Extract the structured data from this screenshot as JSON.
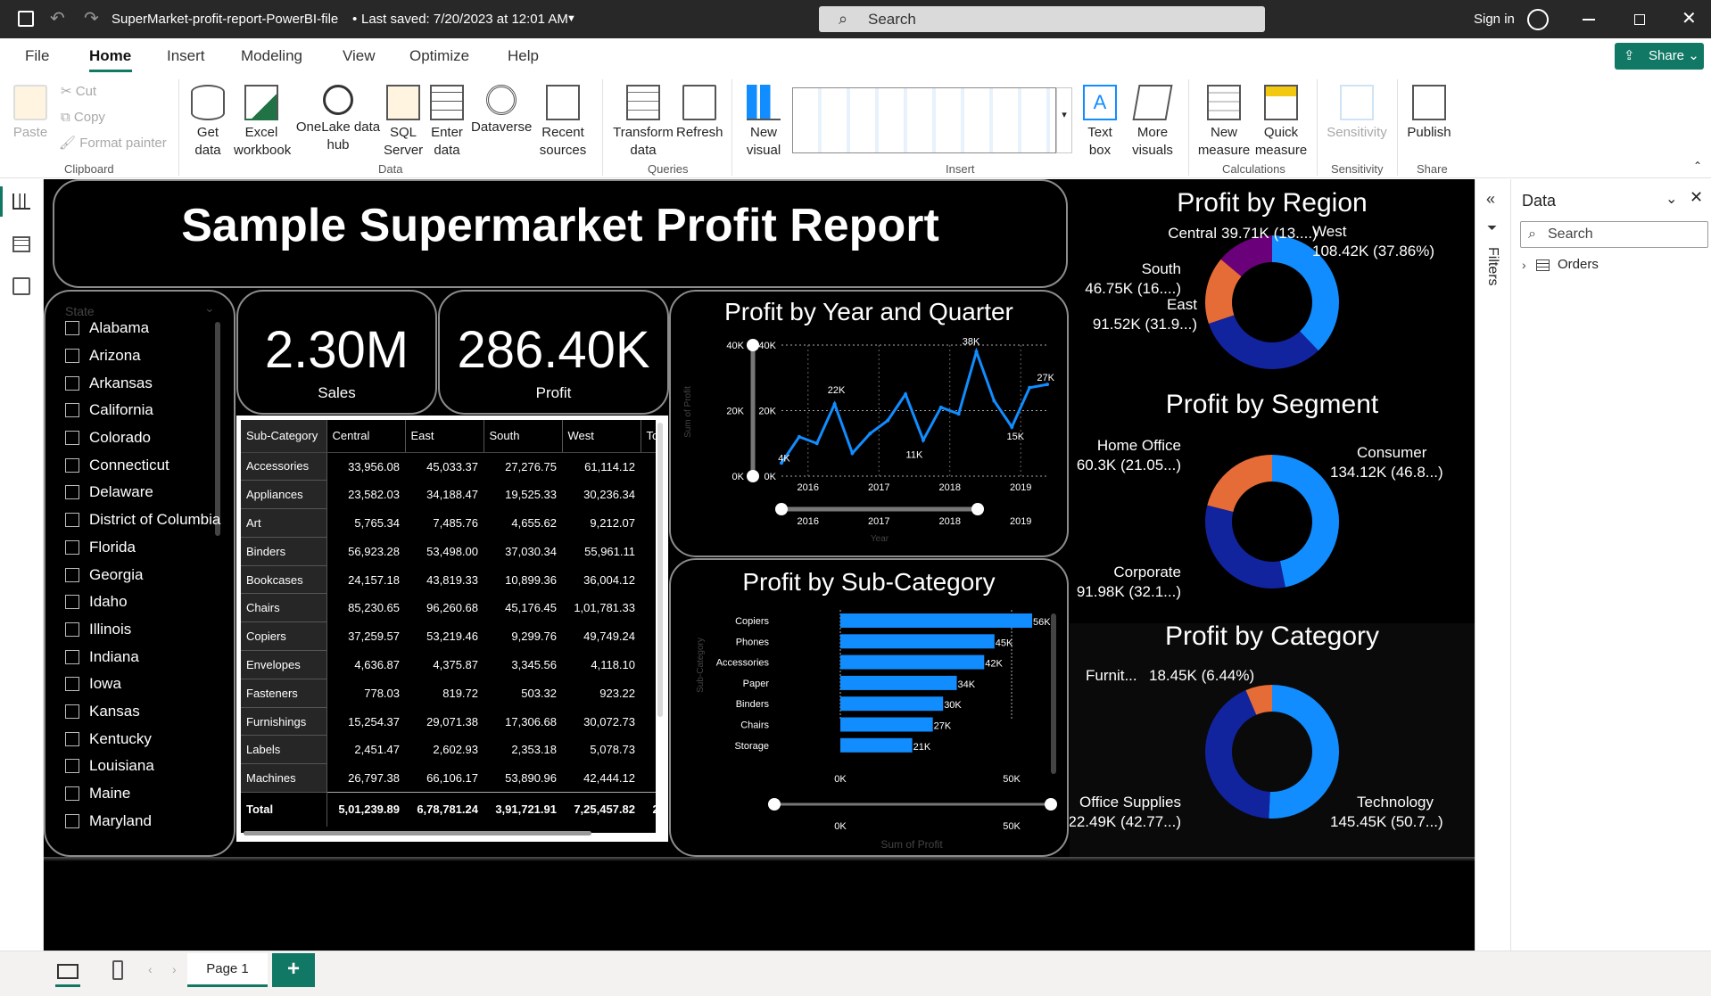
{
  "titlebar": {
    "file_title": "SuperMarket-profit-report-PowerBI-file",
    "saved": "Last saved: 7/20/2023 at 12:01 AM",
    "search_placeholder": "Search",
    "sign_in": "Sign in"
  },
  "menu": [
    "File",
    "Home",
    "Insert",
    "Modeling",
    "View",
    "Optimize",
    "Help"
  ],
  "share_label": "Share",
  "ribbon": {
    "clipboard": {
      "paste": "Paste",
      "cut": "Cut",
      "copy": "Copy",
      "format_painter": "Format painter",
      "group": "Clipboard"
    },
    "data": {
      "items": [
        "Get data",
        "Excel workbook",
        "OneLake data hub",
        "SQL Server",
        "Enter data",
        "Dataverse",
        "Recent sources"
      ],
      "group": "Data"
    },
    "queries": {
      "items": [
        "Transform data",
        "Refresh"
      ],
      "group": "Queries"
    },
    "insert": {
      "new_visual": "New visual",
      "text_box": "Text box",
      "more_visuals": "More visuals",
      "group": "Insert"
    },
    "calculations": {
      "items": [
        "New measure",
        "Quick measure"
      ],
      "group": "Calculations"
    },
    "sensitivity": {
      "item": "Sensitivity",
      "group": "Sensitivity"
    },
    "share": {
      "item": "Publish",
      "group": "Share"
    }
  },
  "report": {
    "title": "Sample Supermarket Profit Report",
    "kpi_sales": {
      "value": "2.30M",
      "label": "Sales"
    },
    "kpi_profit": {
      "value": "286.40K",
      "label": "Profit"
    },
    "state_slicer": {
      "header": "State",
      "items": [
        "Alabama",
        "Arizona",
        "Arkansas",
        "California",
        "Colorado",
        "Connecticut",
        "Delaware",
        "District of Columbia",
        "Florida",
        "Georgia",
        "Idaho",
        "Illinois",
        "Indiana",
        "Iowa",
        "Kansas",
        "Kentucky",
        "Louisiana",
        "Maine",
        "Maryland"
      ]
    },
    "matrix": {
      "headers": [
        "Sub-Category",
        "Central",
        "East",
        "South",
        "West",
        "To"
      ],
      "rows": [
        [
          "Accessories",
          "33,956.08",
          "45,033.37",
          "27,276.75",
          "61,114.12"
        ],
        [
          "Appliances",
          "23,582.03",
          "34,188.47",
          "19,525.33",
          "30,236.34"
        ],
        [
          "Art",
          "5,765.34",
          "7,485.76",
          "4,655.62",
          "9,212.07"
        ],
        [
          "Binders",
          "56,923.28",
          "53,498.00",
          "37,030.34",
          "55,961.11"
        ],
        [
          "Bookcases",
          "24,157.18",
          "43,819.33",
          "10,899.36",
          "36,004.12"
        ],
        [
          "Chairs",
          "85,230.65",
          "96,260.68",
          "45,176.45",
          "1,01,781.33"
        ],
        [
          "Copiers",
          "37,259.57",
          "53,219.46",
          "9,299.76",
          "49,749.24"
        ],
        [
          "Envelopes",
          "4,636.87",
          "4,375.87",
          "3,345.56",
          "4,118.10"
        ],
        [
          "Fasteners",
          "778.03",
          "819.72",
          "503.32",
          "923.22"
        ],
        [
          "Furnishings",
          "15,254.37",
          "29,071.38",
          "17,306.68",
          "30,072.73"
        ],
        [
          "Labels",
          "2,451.47",
          "2,602.93",
          "2,353.18",
          "5,078.73"
        ],
        [
          "Machines",
          "26,797.38",
          "66,106.17",
          "53,890.96",
          "42,444.12"
        ]
      ],
      "total": [
        "Total",
        "5,01,239.89",
        "6,78,781.24",
        "3,91,721.91",
        "7,25,457.82",
        "2"
      ]
    }
  },
  "chart_data": [
    {
      "type": "line",
      "title": "Profit by Year and Quarter",
      "xlabel": "Year",
      "ylabel": "Sum of Profit",
      "x": [
        "2016 Q1",
        "2016 Q2",
        "2016 Q3",
        "2016 Q4",
        "2017 Q1",
        "2017 Q2",
        "2017 Q3",
        "2017 Q4",
        "2018 Q1",
        "2018 Q2",
        "2018 Q3",
        "2018 Q4",
        "2019 Q1",
        "2019 Q2",
        "2019 Q3",
        "2019 Q4"
      ],
      "values": [
        4000,
        12000,
        10000,
        22000,
        7000,
        13000,
        17000,
        25000,
        11000,
        21000,
        19000,
        38000,
        23000,
        15000,
        27000,
        28000
      ],
      "data_labels": [
        "4K",
        "22K",
        "11K",
        "38K",
        "15K",
        "27K"
      ],
      "ylim": [
        0,
        40000
      ],
      "yticks": [
        "0K",
        "20K",
        "40K"
      ],
      "xticks": [
        "2016",
        "2017",
        "2018",
        "2019"
      ],
      "color": "#118DFF"
    },
    {
      "type": "bar",
      "title": "Profit by Sub-Category",
      "xlabel": "Sum of Profit",
      "ylabel": "Sub-Category",
      "categories": [
        "Copiers",
        "Phones",
        "Accessories",
        "Paper",
        "Binders",
        "Chairs",
        "Storage"
      ],
      "values": [
        56000,
        45000,
        42000,
        34000,
        30000,
        27000,
        21000
      ],
      "data_labels": [
        "56K",
        "45K",
        "42K",
        "34K",
        "30K",
        "27K",
        "21K"
      ],
      "xlim": [
        0,
        50000
      ],
      "xticks": [
        "0K",
        "50K"
      ],
      "color": "#118DFF"
    },
    {
      "type": "pie",
      "title": "Profit by Region",
      "donut": true,
      "slices": [
        {
          "label": "West",
          "value": 108.42,
          "text": "West",
          "val_text": "108.42K (37.86%)",
          "color": "#118DFF"
        },
        {
          "label": "East",
          "value": 91.52,
          "text": "East",
          "val_text": "91.52K (31.9...)",
          "color": "#12239E"
        },
        {
          "label": "South",
          "value": 46.75,
          "text": "South",
          "val_text": "46.75K (16....)",
          "color": "#E66C37"
        },
        {
          "label": "Central",
          "value": 39.71,
          "text": "Central",
          "val_text": "39.71K (13....)",
          "color": "#6B007B"
        }
      ]
    },
    {
      "type": "pie",
      "title": "Profit by Segment",
      "donut": true,
      "slices": [
        {
          "label": "Consumer",
          "value": 134.12,
          "text": "Consumer",
          "val_text": "134.12K (46.8...)",
          "color": "#118DFF"
        },
        {
          "label": "Corporate",
          "value": 91.98,
          "text": "Corporate",
          "val_text": "91.98K (32.1...)",
          "color": "#12239E"
        },
        {
          "label": "Home Office",
          "value": 60.3,
          "text": "Home Office",
          "val_text": "60.3K (21.05...)",
          "color": "#E66C37"
        }
      ]
    },
    {
      "type": "pie",
      "title": "Profit by Category",
      "donut": true,
      "slices": [
        {
          "label": "Technology",
          "value": 145.45,
          "text": "Technology",
          "val_text": "145.45K (50.7...)",
          "color": "#118DFF"
        },
        {
          "label": "Office Supplies",
          "value": 122.49,
          "text": "Office Supplies",
          "val_text": "122.49K (42.77...)",
          "color": "#12239E"
        },
        {
          "label": "Furniture",
          "value": 18.45,
          "text": "Furnit...",
          "val_text": "18.45K (6.44%)",
          "color": "#E66C37"
        }
      ]
    }
  ],
  "right_panes": {
    "filters_label": "Filters",
    "data_title": "Data",
    "data_search": "Search",
    "table_item": "Orders"
  },
  "bottom": {
    "page_tab": "Page 1",
    "add_page": "+"
  }
}
